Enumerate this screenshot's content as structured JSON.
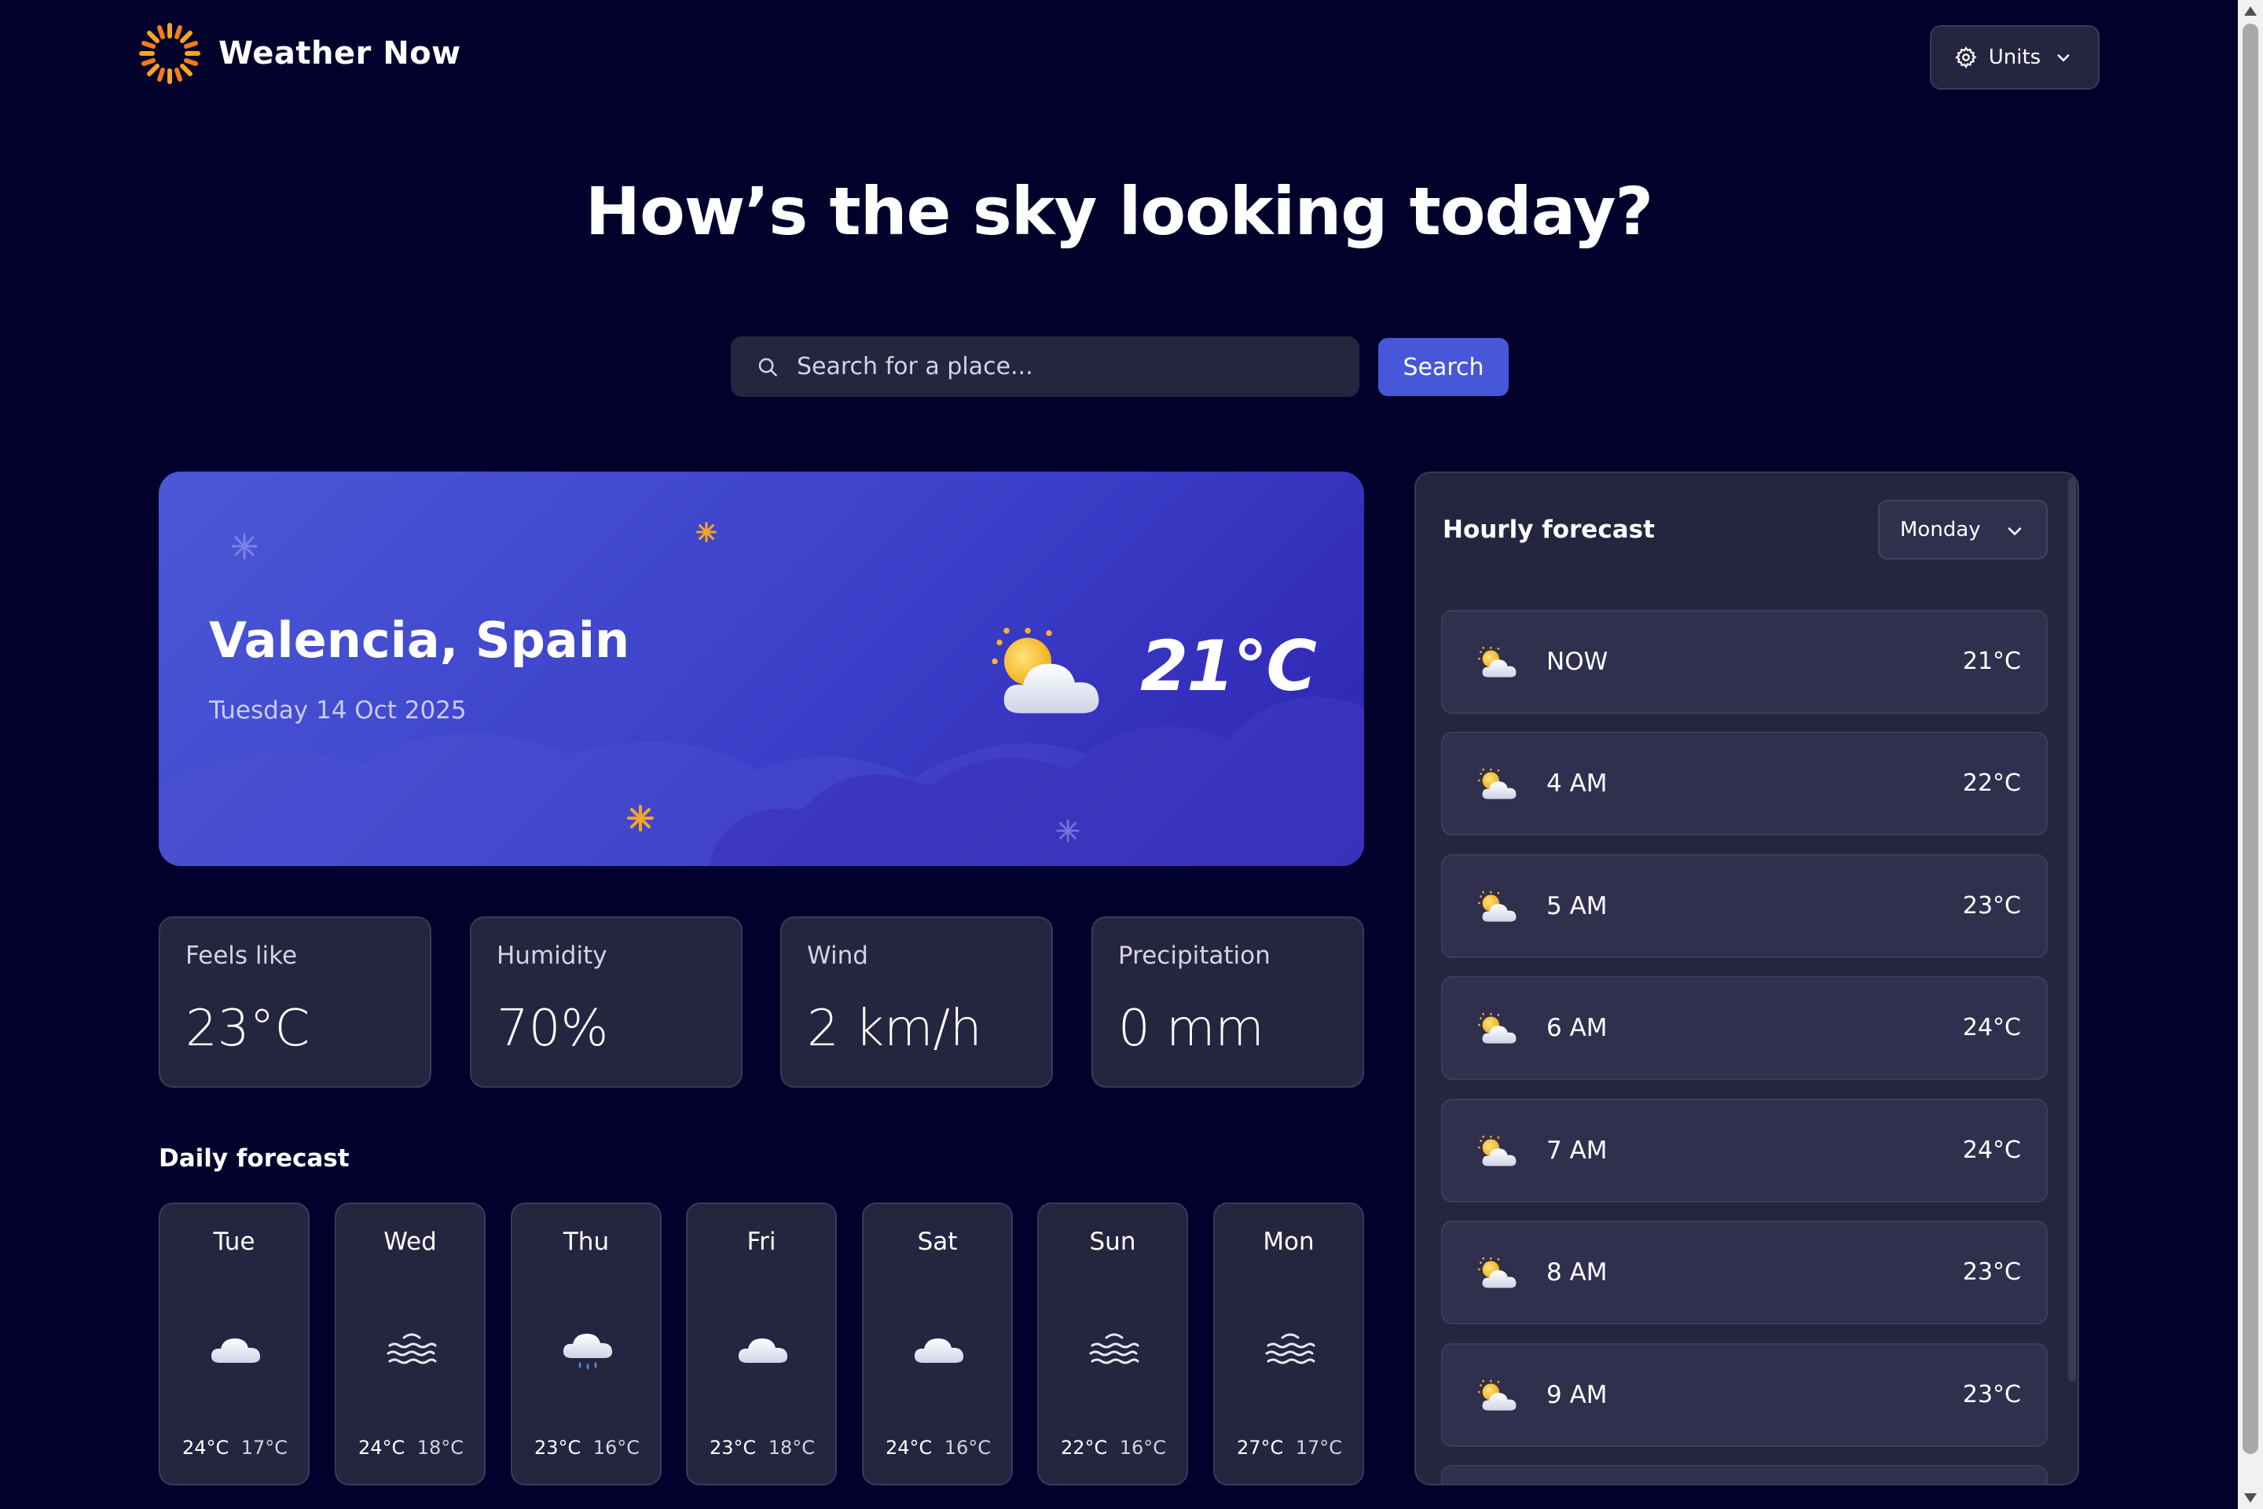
{
  "app": {
    "name": "Weather Now"
  },
  "header": {
    "units_label": "Units"
  },
  "headline": "How’s the sky looking today?",
  "search": {
    "placeholder": "Search for a place...",
    "button_label": "Search"
  },
  "current": {
    "location": "Valencia, Spain",
    "date": "Tuesday 14 Oct 2025",
    "temperature": "21°C",
    "icon": "partly-cloudy-icon"
  },
  "stats": [
    {
      "label": "Feels like",
      "value": "23°C"
    },
    {
      "label": "Humidity",
      "value": "70%"
    },
    {
      "label": "Wind",
      "value": "2 km/h"
    },
    {
      "label": "Precipitation",
      "value": "0 mm"
    }
  ],
  "daily": {
    "title": "Daily forecast",
    "days": [
      {
        "day": "Tue",
        "icon": "cloud-icon",
        "high": "24°C",
        "low": "17°C"
      },
      {
        "day": "Wed",
        "icon": "fog-icon",
        "high": "24°C",
        "low": "18°C"
      },
      {
        "day": "Thu",
        "icon": "drizzle-icon",
        "high": "23°C",
        "low": "16°C"
      },
      {
        "day": "Fri",
        "icon": "cloud-icon",
        "high": "23°C",
        "low": "18°C"
      },
      {
        "day": "Sat",
        "icon": "cloud-icon",
        "high": "24°C",
        "low": "16°C"
      },
      {
        "day": "Sun",
        "icon": "fog-icon",
        "high": "22°C",
        "low": "16°C"
      },
      {
        "day": "Mon",
        "icon": "fog-icon",
        "high": "27°C",
        "low": "17°C"
      }
    ]
  },
  "hourly": {
    "title": "Hourly forecast",
    "selected_day": "Monday",
    "hours": [
      {
        "time": "NOW",
        "temp": "21°C",
        "icon": "partly-cloudy-icon"
      },
      {
        "time": "4 AM",
        "temp": "22°C",
        "icon": "partly-cloudy-icon"
      },
      {
        "time": "5 AM",
        "temp": "23°C",
        "icon": "partly-cloudy-icon"
      },
      {
        "time": "6 AM",
        "temp": "24°C",
        "icon": "partly-cloudy-icon"
      },
      {
        "time": "7 AM",
        "temp": "24°C",
        "icon": "partly-cloudy-icon"
      },
      {
        "time": "8 AM",
        "temp": "23°C",
        "icon": "partly-cloudy-icon"
      },
      {
        "time": "9 AM",
        "temp": "23°C",
        "icon": "partly-cloudy-icon"
      }
    ]
  },
  "colors": {
    "background": "#02012b",
    "card": "#262540",
    "accent": "#4658d9",
    "sun": "#f5a524"
  }
}
